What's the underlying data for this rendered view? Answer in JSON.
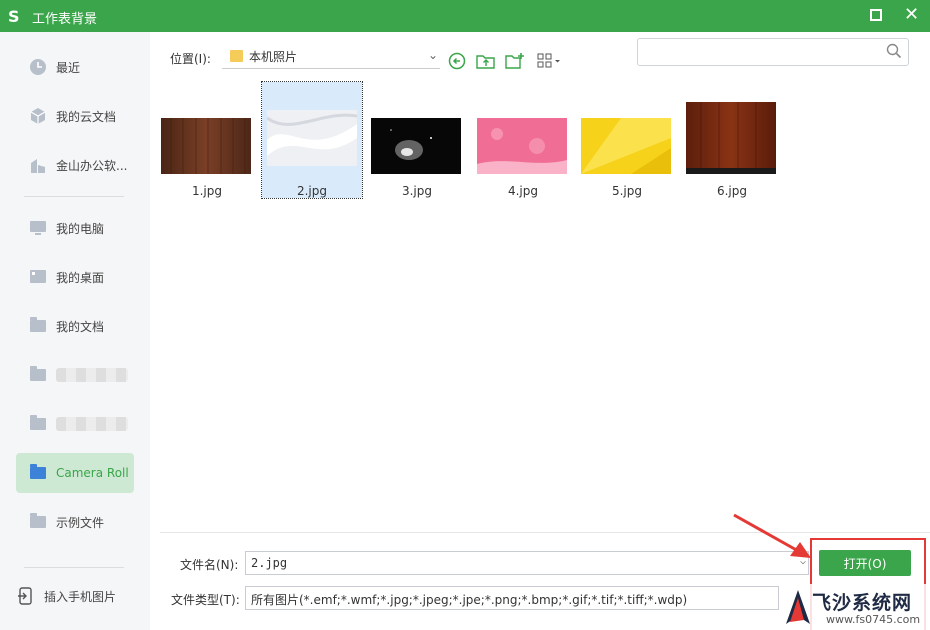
{
  "window": {
    "title": "工作表背景",
    "logo_glyph": "S",
    "close_glyph": "✕"
  },
  "sidebar": {
    "items": [
      {
        "label": "最近",
        "icon": "clock-icon"
      },
      {
        "label": "我的云文档",
        "icon": "cloud-doc-icon"
      },
      {
        "label": "金山办公软...",
        "icon": "building-icon"
      },
      {
        "label": "我的电脑",
        "icon": "computer-icon"
      },
      {
        "label": "我的桌面",
        "icon": "desktop-icon"
      },
      {
        "label": "我的文档",
        "icon": "folder-icon"
      },
      {
        "label": "",
        "icon": "folder-icon",
        "blurred": true
      },
      {
        "label": "",
        "icon": "folder-icon",
        "blurred": true
      },
      {
        "label": "Camera Roll",
        "icon": "folder-icon",
        "active": true
      },
      {
        "label": "示例文件",
        "icon": "folder-icon"
      }
    ],
    "insert_phone_image": "插入手机图片"
  },
  "toolbar": {
    "location_label": "位置(I):",
    "path_value": "本机照片",
    "search_placeholder": ""
  },
  "files": [
    {
      "name": "1.jpg",
      "selected": false,
      "thumb": "wood-dark"
    },
    {
      "name": "2.jpg",
      "selected": true,
      "thumb": "white-silk"
    },
    {
      "name": "3.jpg",
      "selected": false,
      "thumb": "nebula"
    },
    {
      "name": "4.jpg",
      "selected": false,
      "thumb": "pink-bokeh"
    },
    {
      "name": "5.jpg",
      "selected": false,
      "thumb": "yellow-geo"
    },
    {
      "name": "6.jpg",
      "selected": false,
      "thumb": "wood-red"
    }
  ],
  "footer": {
    "filename_label": "文件名(N):",
    "filename_value": "2.jpg",
    "filetype_label": "文件类型(T):",
    "filetype_value": "所有图片(*.emf;*.wmf;*.jpg;*.jpeg;*.jpe;*.png;*.bmp;*.gif;*.tif;*.tiff;*.wdp)",
    "open_button": "打开(O)"
  },
  "watermark": {
    "text": "飞沙系统网",
    "url": "www.fs0745.com"
  },
  "colors": {
    "accent": "#3aa54a",
    "highlight": "#e53935",
    "selection": "#d9ebfb"
  }
}
